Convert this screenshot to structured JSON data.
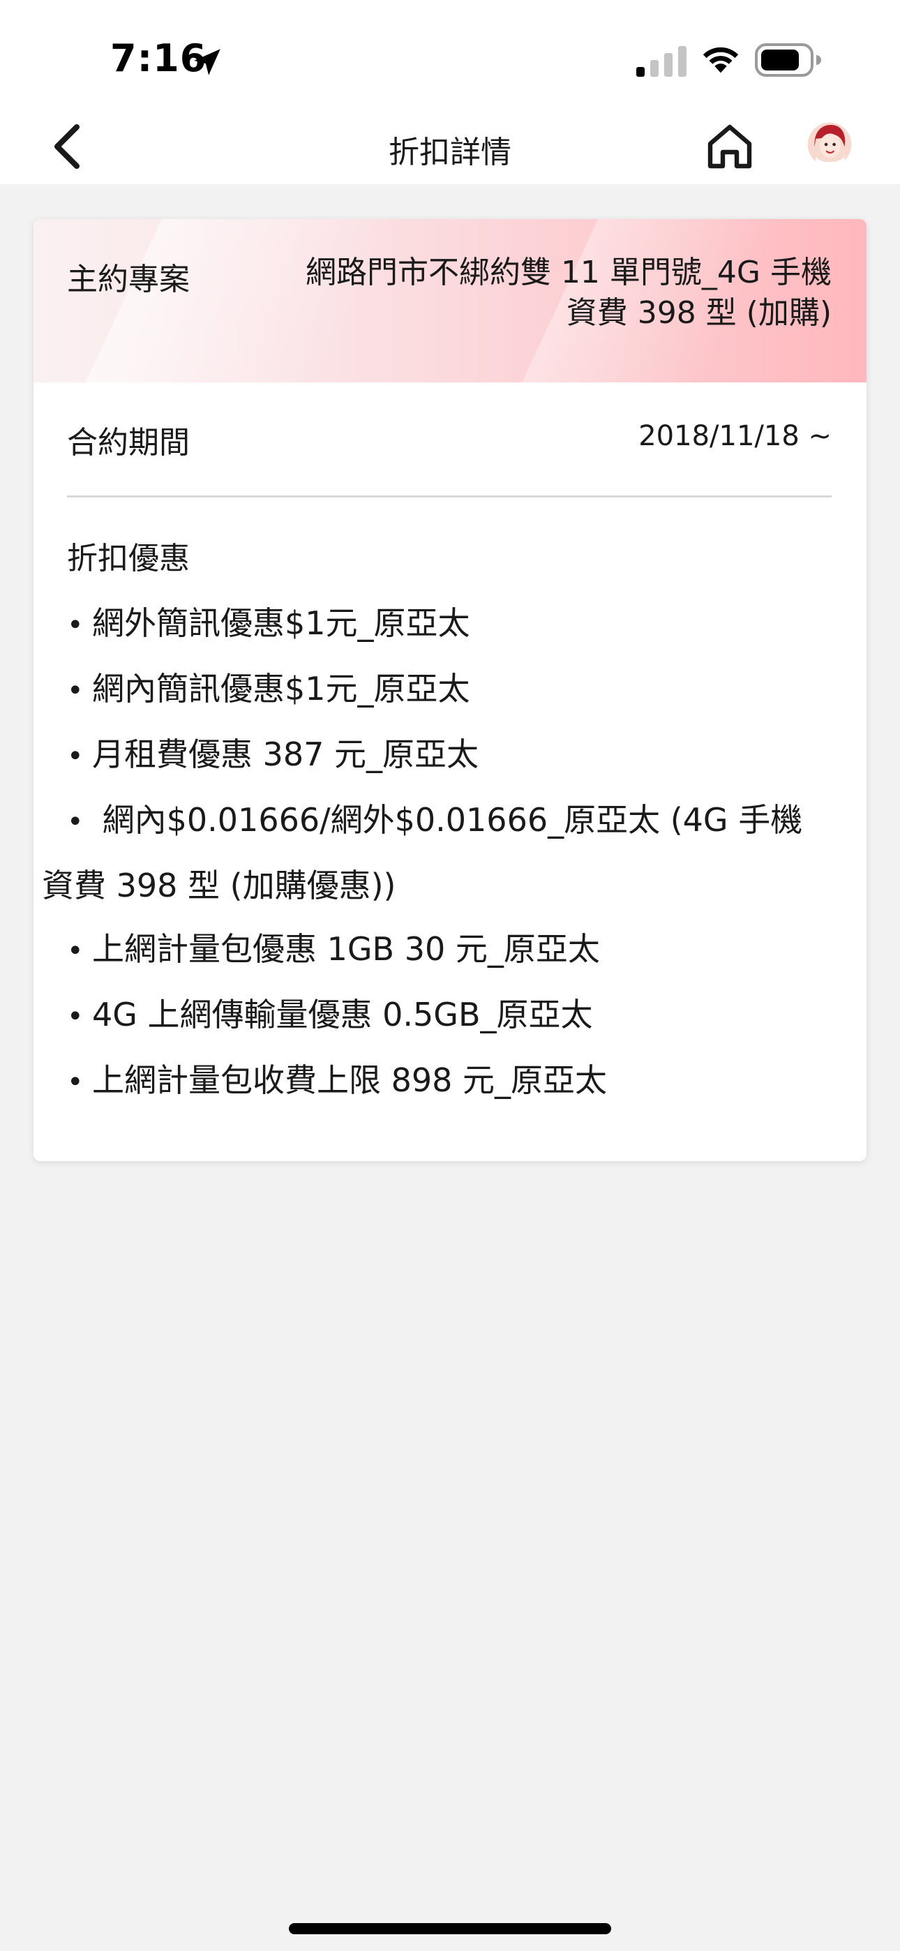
{
  "status_bar": {
    "time": "7:16"
  },
  "nav": {
    "title": "折扣詳情"
  },
  "card": {
    "plan_label": "主約專案",
    "plan_value_line1": "網路門市不綁約雙 11 單門號_4G 手機",
    "plan_value_line2": "資費 398 型 (加購)",
    "period_label": "合約期間",
    "period_value": "2018/11/18 ~",
    "discount_label": "折扣優惠",
    "discounts": [
      "網外簡訊優惠$1元_原亞太",
      "網內簡訊優惠$1元_原亞太",
      "月租費優惠 387 元_原亞太",
      "網內$0.01666/網外$0.01666_原亞太 (4G 手機",
      "資費 398 型 (加購優惠))",
      "上網計量包優惠 1GB 30 元_原亞太",
      "4G 上網傳輸量優惠 0.5GB_原亞太",
      "上網計量包收費上限 898 元_原亞太"
    ]
  },
  "colors": {
    "header_gradient_start": "#fbf1f2",
    "header_gradient_end": "#ffb8bd",
    "background": "#f2f2f2"
  }
}
